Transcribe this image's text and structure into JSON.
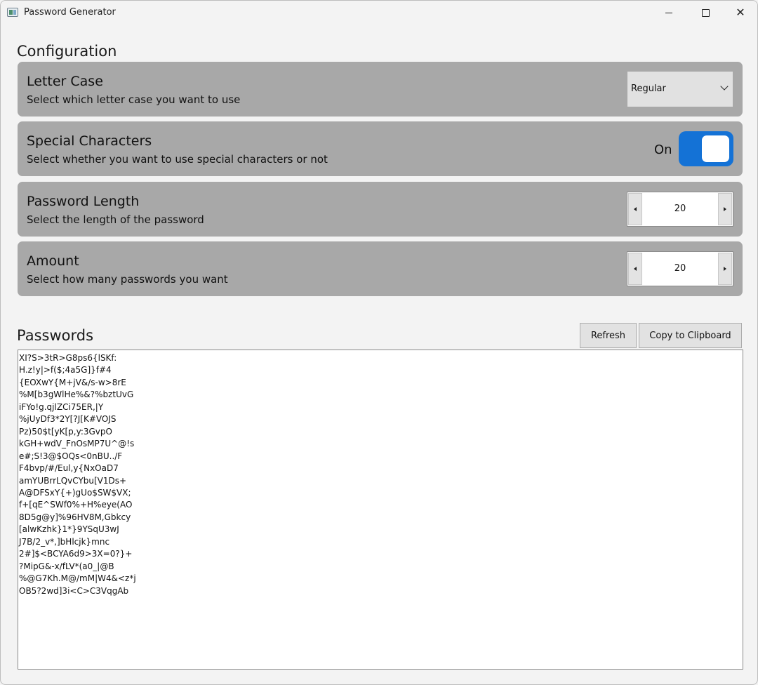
{
  "window": {
    "title": "Password Generator"
  },
  "configuration": {
    "heading": "Configuration",
    "letter_case": {
      "title": "Letter Case",
      "description": "Select which letter case you want to use",
      "selected": "Regular"
    },
    "special_characters": {
      "title": "Special Characters",
      "description": "Select whether you want to use special characters or not",
      "state_label": "On",
      "enabled": true,
      "accent_color": "#1472d6"
    },
    "password_length": {
      "title": "Password Length",
      "description": "Select the length of the password",
      "value": "20"
    },
    "amount": {
      "title": "Amount",
      "description": "Select how many passwords you want",
      "value": "20"
    }
  },
  "passwords": {
    "heading": "Passwords",
    "refresh_label": "Refresh",
    "copy_label": "Copy to Clipboard",
    "items": [
      "XI?S>3tR>G8ps6{lSKf:",
      "H.z!y|>f($;4a5G]}f#4",
      "{EOXwY{M+jV&/s-w>8rE",
      "%M[b3gWlHe%&?%bztUvG",
      "iFYo!g.qjlZCi75ER,|Y",
      "%jUyDf3*2Y[?J[K#VOJS",
      "Pz)50$t[yK[p,y:3GvpO",
      "kGH+wdV_FnOsMP7U^@!s",
      "e#;S!3@$OQs<0nBU../F",
      "F4bvp/#/Eul,y{NxOaD7",
      "amYUBrrLQvCYbu[V1Ds+",
      "A@DFSxY{+)gUo$SW$VX;",
      "f+[qE^SWf0%+H%eye(AO",
      "8D5g@y]%96HV8M,Gbkcy",
      "[alwKzhk}1*}9YSqU3wJ",
      "J7B/2_v*,]bHlcjk}mnc",
      "2#]$<BCYA6d9>3X=0?}+",
      "?MipG&-x/fLV*(a0_|@B",
      "%@G7Kh.M@/mM|W4&<z*j",
      "OB5?2wd]3i<C>C3VqgAb"
    ]
  }
}
